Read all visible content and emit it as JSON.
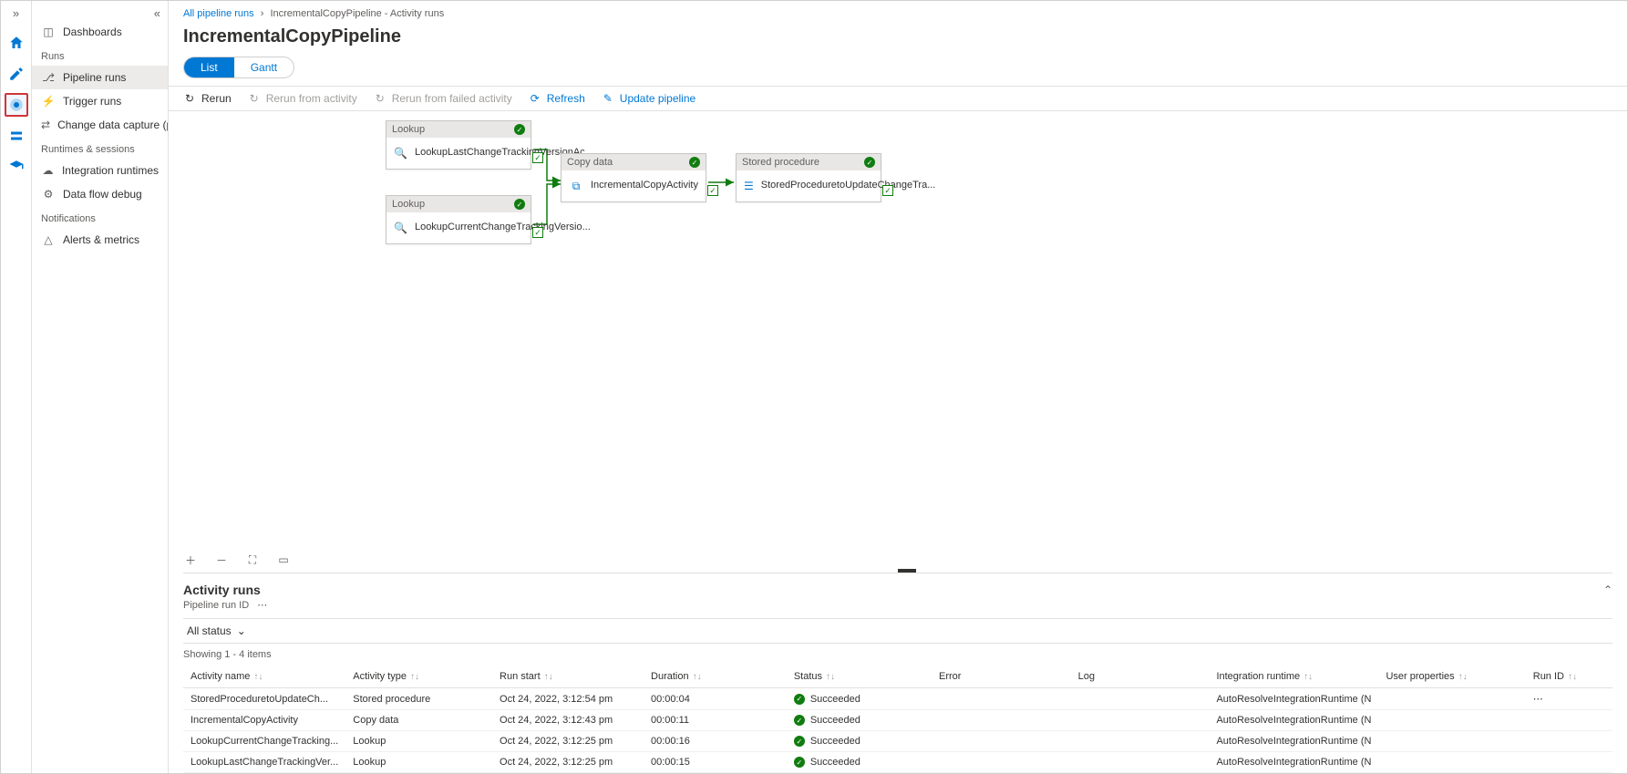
{
  "breadcrumb": {
    "root": "All pipeline runs",
    "current": "IncrementalCopyPipeline - Activity runs"
  },
  "title": "IncrementalCopyPipeline",
  "tabs": {
    "list": "List",
    "gantt": "Gantt"
  },
  "toolbar": {
    "rerun": "Rerun",
    "rerun_activity": "Rerun from activity",
    "rerun_failed": "Rerun from failed activity",
    "refresh": "Refresh",
    "update": "Update pipeline"
  },
  "nav": {
    "dashboards": "Dashboards",
    "runs_section": "Runs",
    "pipeline_runs": "Pipeline runs",
    "trigger_runs": "Trigger runs",
    "cdc": "Change data capture (previ...",
    "runtimes_section": "Runtimes & sessions",
    "integration_runtimes": "Integration runtimes",
    "data_flow_debug": "Data flow debug",
    "notifications_section": "Notifications",
    "alerts": "Alerts & metrics"
  },
  "nodes": {
    "lookup1_type": "Lookup",
    "lookup1_name": "LookupLastChangeTrackingVersionAc...",
    "lookup2_type": "Lookup",
    "lookup2_name": "LookupCurrentChangeTrackingVersio...",
    "copy_type": "Copy data",
    "copy_name": "IncrementalCopyActivity",
    "sp_type": "Stored procedure",
    "sp_name": "StoredProceduretoUpdateChangeTra..."
  },
  "activity_runs": {
    "heading": "Activity runs",
    "pipeline_run_id_label": "Pipeline run ID",
    "filter": "All status",
    "showing": "Showing 1 - 4 items",
    "cols": {
      "activity_name": "Activity name",
      "activity_type": "Activity type",
      "run_start": "Run start",
      "duration": "Duration",
      "status": "Status",
      "error": "Error",
      "log": "Log",
      "integration_runtime": "Integration runtime",
      "user_properties": "User properties",
      "run_id": "Run ID"
    },
    "rows": [
      {
        "name": "StoredProceduretoUpdateCh...",
        "type": "Stored procedure",
        "start": "Oct 24, 2022, 3:12:54 pm",
        "dur": "00:00:04",
        "status": "Succeeded",
        "ir": "AutoResolveIntegrationRuntime (N"
      },
      {
        "name": "IncrementalCopyActivity",
        "type": "Copy data",
        "start": "Oct 24, 2022, 3:12:43 pm",
        "dur": "00:00:11",
        "status": "Succeeded",
        "ir": "AutoResolveIntegrationRuntime (N"
      },
      {
        "name": "LookupCurrentChangeTracking...",
        "type": "Lookup",
        "start": "Oct 24, 2022, 3:12:25 pm",
        "dur": "00:00:16",
        "status": "Succeeded",
        "ir": "AutoResolveIntegrationRuntime (N"
      },
      {
        "name": "LookupLastChangeTrackingVer...",
        "type": "Lookup",
        "start": "Oct 24, 2022, 3:12:25 pm",
        "dur": "00:00:15",
        "status": "Succeeded",
        "ir": "AutoResolveIntegrationRuntime (N"
      }
    ]
  }
}
